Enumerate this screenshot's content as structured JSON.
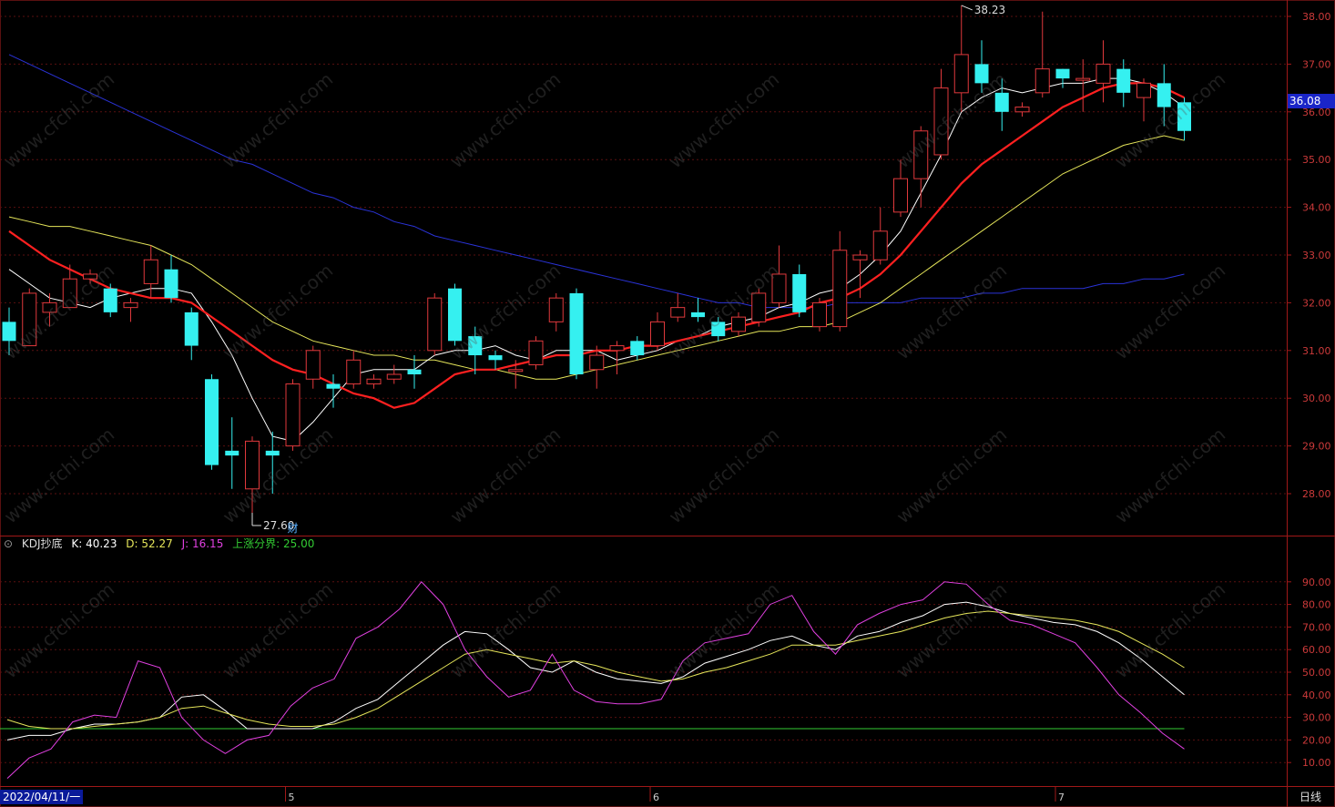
{
  "watermark": "www.cfchi.com",
  "colors": {
    "up": "#e0393c",
    "down": "#35f0f0",
    "ma_white": "#ffffff",
    "ma_red": "#ff2020",
    "ma_yellow": "#e6e65a",
    "ma_blue": "#2a33d8",
    "k": "#ffffff",
    "d": "#e6e65a",
    "j": "#e040e0",
    "threshold": "#33cc33",
    "grid": "#5a1010"
  },
  "header": {
    "indicator": "KDJ抄底",
    "k_label": "K: 40.23",
    "d_label": "D: 52.27",
    "j_label": "J: 16.15",
    "threshold_label": "上涨分界: 25.00"
  },
  "price_tag": "36.08",
  "start_date": "2022/04/11/一",
  "period": "日线",
  "high_marker": "38.23",
  "low_marker": "27.60",
  "event_marker": "财",
  "chart_data": [
    {
      "type": "candlestick",
      "title": "",
      "ylim": [
        27.2,
        38.3
      ],
      "y_ticks": [
        "28.00",
        "29.00",
        "30.00",
        "31.00",
        "32.00",
        "33.00",
        "34.00",
        "35.00",
        "36.00",
        "37.00",
        "38.00"
      ],
      "x_ticks": [
        {
          "label": "5",
          "index": 14
        },
        {
          "label": "6",
          "index": 32
        },
        {
          "label": "7",
          "index": 52
        }
      ],
      "candles": [
        [
          31.6,
          31.2,
          31.9,
          30.9
        ],
        [
          31.1,
          32.2,
          32.3,
          31.1
        ],
        [
          31.8,
          32.0,
          32.2,
          31.5
        ],
        [
          31.9,
          32.5,
          32.8,
          31.9
        ],
        [
          32.5,
          32.6,
          32.7,
          32.4
        ],
        [
          32.3,
          31.8,
          32.4,
          31.7
        ],
        [
          31.9,
          32.0,
          32.1,
          31.6
        ],
        [
          32.4,
          32.9,
          33.2,
          32.1
        ],
        [
          32.7,
          32.1,
          33.0,
          32.0
        ],
        [
          31.8,
          31.1,
          31.9,
          30.8
        ],
        [
          30.4,
          28.6,
          30.5,
          28.5
        ],
        [
          28.9,
          28.8,
          29.6,
          28.1
        ],
        [
          28.1,
          29.1,
          29.2,
          27.6
        ],
        [
          28.9,
          28.8,
          29.3,
          28.0
        ],
        [
          29.0,
          30.3,
          30.4,
          28.9
        ],
        [
          30.4,
          31.0,
          31.1,
          30.2
        ],
        [
          30.3,
          30.2,
          30.5,
          29.8
        ],
        [
          30.3,
          30.8,
          31.0,
          30.2
        ],
        [
          30.3,
          30.4,
          30.5,
          30.2
        ],
        [
          30.4,
          30.5,
          30.7,
          30.3
        ],
        [
          30.6,
          30.5,
          30.9,
          30.2
        ],
        [
          31.0,
          32.1,
          32.2,
          30.9
        ],
        [
          32.3,
          31.2,
          32.4,
          31.1
        ],
        [
          31.3,
          30.9,
          31.5,
          30.5
        ],
        [
          30.9,
          30.8,
          31.0,
          30.6
        ],
        [
          30.6,
          30.6,
          30.8,
          30.2
        ],
        [
          30.7,
          31.2,
          31.3,
          30.6
        ],
        [
          31.6,
          32.1,
          32.2,
          31.4
        ],
        [
          32.2,
          30.5,
          32.3,
          30.4
        ],
        [
          30.6,
          30.9,
          31.1,
          30.2
        ],
        [
          31.0,
          31.1,
          31.2,
          30.5
        ],
        [
          31.2,
          30.9,
          31.3,
          30.8
        ],
        [
          31.1,
          31.6,
          31.8,
          31.0
        ],
        [
          31.7,
          31.9,
          32.2,
          31.6
        ],
        [
          31.8,
          31.7,
          32.1,
          31.6
        ],
        [
          31.6,
          31.3,
          31.7,
          31.2
        ],
        [
          31.4,
          31.7,
          31.8,
          31.3
        ],
        [
          31.6,
          32.2,
          32.3,
          31.5
        ],
        [
          32.0,
          32.6,
          33.2,
          31.9
        ],
        [
          32.6,
          31.8,
          32.8,
          31.7
        ],
        [
          31.5,
          32.0,
          32.1,
          31.4
        ],
        [
          31.5,
          33.1,
          33.5,
          31.4
        ],
        [
          32.9,
          33.0,
          33.1,
          32.1
        ],
        [
          32.9,
          33.5,
          34.0,
          32.8
        ],
        [
          33.9,
          34.6,
          35.0,
          33.8
        ],
        [
          34.6,
          35.6,
          35.7,
          34.0
        ],
        [
          35.1,
          36.5,
          36.9,
          35.0
        ],
        [
          36.4,
          37.2,
          38.23,
          36.0
        ],
        [
          37.0,
          36.6,
          37.5,
          36.4
        ],
        [
          36.4,
          36.0,
          36.7,
          35.6
        ],
        [
          36.0,
          36.1,
          36.2,
          35.9
        ],
        [
          36.4,
          36.9,
          38.1,
          36.3
        ],
        [
          36.9,
          36.7,
          36.9,
          36.5
        ],
        [
          36.7,
          36.7,
          37.1,
          36.0
        ],
        [
          36.6,
          37.0,
          37.5,
          36.2
        ],
        [
          36.9,
          36.4,
          37.1,
          36.1
        ],
        [
          36.3,
          36.6,
          36.7,
          35.8
        ],
        [
          36.6,
          36.1,
          37.0,
          35.7
        ],
        [
          36.2,
          35.6,
          36.3,
          35.4
        ]
      ],
      "ma_series": [
        {
          "color_key": "ma_white",
          "values": [
            32.7,
            32.4,
            32.1,
            32.0,
            31.9,
            32.1,
            32.2,
            32.3,
            32.3,
            32.2,
            31.6,
            30.9,
            30.0,
            29.2,
            29.1,
            29.5,
            30.0,
            30.5,
            30.6,
            30.6,
            30.6,
            30.9,
            31.0,
            31.0,
            31.1,
            30.9,
            30.8,
            31.0,
            31.0,
            31.0,
            30.8,
            30.9,
            31.0,
            31.2,
            31.3,
            31.5,
            31.6,
            31.7,
            31.9,
            32.0,
            32.2,
            32.3,
            32.6,
            33.0,
            33.5,
            34.3,
            35.1,
            36.0,
            36.3,
            36.5,
            36.4,
            36.5,
            36.6,
            36.6,
            36.7,
            36.7,
            36.6,
            36.4,
            36.1
          ]
        },
        {
          "color_key": "ma_red",
          "values": [
            33.5,
            33.2,
            32.9,
            32.7,
            32.5,
            32.3,
            32.2,
            32.1,
            32.1,
            32.0,
            31.7,
            31.4,
            31.1,
            30.8,
            30.6,
            30.5,
            30.3,
            30.1,
            30.0,
            29.8,
            29.9,
            30.2,
            30.5,
            30.6,
            30.6,
            30.7,
            30.8,
            30.9,
            30.9,
            31.0,
            31.0,
            31.1,
            31.1,
            31.2,
            31.3,
            31.4,
            31.5,
            31.6,
            31.7,
            31.8,
            32.0,
            32.1,
            32.3,
            32.6,
            33.0,
            33.5,
            34.0,
            34.5,
            34.9,
            35.2,
            35.5,
            35.8,
            36.1,
            36.3,
            36.5,
            36.6,
            36.6,
            36.5,
            36.3
          ]
        },
        {
          "color_key": "ma_yellow",
          "values": [
            33.8,
            33.7,
            33.6,
            33.6,
            33.5,
            33.4,
            33.3,
            33.2,
            33.0,
            32.8,
            32.5,
            32.2,
            31.9,
            31.6,
            31.4,
            31.2,
            31.1,
            31.0,
            30.9,
            30.9,
            30.8,
            30.8,
            30.7,
            30.6,
            30.6,
            30.5,
            30.4,
            30.4,
            30.5,
            30.6,
            30.7,
            30.8,
            30.9,
            31.0,
            31.1,
            31.2,
            31.3,
            31.4,
            31.4,
            31.5,
            31.5,
            31.6,
            31.8,
            32.0,
            32.3,
            32.6,
            32.9,
            33.2,
            33.5,
            33.8,
            34.1,
            34.4,
            34.7,
            34.9,
            35.1,
            35.3,
            35.4,
            35.5,
            35.4
          ]
        },
        {
          "color_key": "ma_blue",
          "values": [
            37.2,
            37.0,
            36.8,
            36.6,
            36.4,
            36.2,
            36.0,
            35.8,
            35.6,
            35.4,
            35.2,
            35.0,
            34.9,
            34.7,
            34.5,
            34.3,
            34.2,
            34.0,
            33.9,
            33.7,
            33.6,
            33.4,
            33.3,
            33.2,
            33.1,
            33.0,
            32.9,
            32.8,
            32.7,
            32.6,
            32.5,
            32.4,
            32.3,
            32.2,
            32.1,
            32.0,
            32.0,
            31.9,
            31.9,
            31.9,
            31.9,
            32.0,
            32.0,
            32.0,
            32.0,
            32.1,
            32.1,
            32.1,
            32.2,
            32.2,
            32.3,
            32.3,
            32.3,
            32.3,
            32.4,
            32.4,
            32.5,
            32.5,
            32.6
          ]
        }
      ]
    },
    {
      "type": "line",
      "title": "KDJ抄底",
      "ylim": [
        0,
        100
      ],
      "y_ticks": [
        "10.00",
        "20.00",
        "30.00",
        "40.00",
        "50.00",
        "60.00",
        "70.00",
        "80.00",
        "90.00"
      ],
      "threshold": 25.0,
      "series": [
        {
          "name": "K",
          "color_key": "k",
          "values": [
            20,
            22,
            22,
            25,
            27,
            27,
            28,
            30,
            39,
            40,
            33,
            25,
            25,
            25,
            25,
            28,
            34,
            38,
            46,
            54,
            62,
            68,
            67,
            60,
            52,
            50,
            55,
            50,
            47,
            46,
            45,
            48,
            54,
            57,
            60,
            64,
            66,
            62,
            60,
            66,
            68,
            72,
            75,
            80,
            81,
            79,
            76,
            74,
            72,
            71,
            68,
            63,
            56,
            48,
            40
          ]
        },
        {
          "name": "D",
          "color_key": "d",
          "values": [
            29,
            26,
            25,
            25,
            26,
            27,
            28,
            30,
            34,
            35,
            32,
            29,
            27,
            26,
            26,
            27,
            30,
            34,
            40,
            46,
            52,
            58,
            60,
            58,
            56,
            54,
            55,
            53,
            50,
            48,
            46,
            47,
            50,
            52,
            55,
            58,
            62,
            62,
            62,
            64,
            66,
            68,
            71,
            74,
            76,
            77,
            76,
            75,
            74,
            73,
            71,
            68,
            63,
            58,
            52
          ]
        },
        {
          "name": "J",
          "color_key": "j",
          "values": [
            3,
            12,
            16,
            28,
            31,
            30,
            55,
            52,
            30,
            20,
            14,
            20,
            22,
            35,
            43,
            47,
            65,
            70,
            78,
            90,
            80,
            60,
            48,
            39,
            42,
            58,
            42,
            37,
            36,
            36,
            38,
            55,
            63,
            65,
            67,
            80,
            84,
            68,
            58,
            71,
            76,
            80,
            82,
            90,
            89,
            80,
            73,
            71,
            67,
            63,
            52,
            40,
            32,
            23,
            16
          ]
        }
      ]
    }
  ]
}
